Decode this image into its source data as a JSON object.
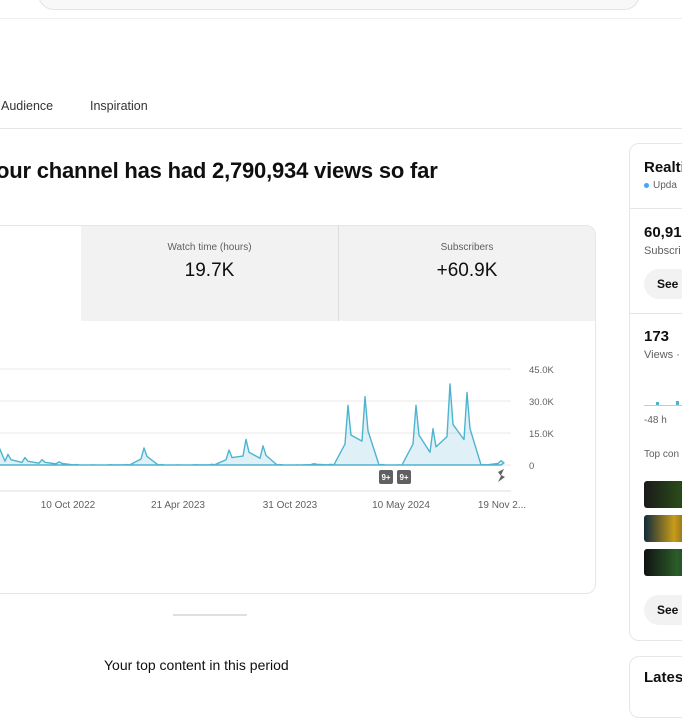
{
  "tabs": [
    {
      "label": "Audience"
    },
    {
      "label": "Inspiration"
    }
  ],
  "headline": "our channel has had 2,790,934 views so far",
  "metrics": [
    {
      "label": "Watch time (hours)",
      "value": "19.7K"
    },
    {
      "label": "Subscribers",
      "value": "+60.9K"
    }
  ],
  "chart_data": {
    "type": "area",
    "y_ticks": [
      "45.0K",
      "30.0K",
      "15.0K",
      "0"
    ],
    "ylim": [
      0,
      45000
    ],
    "x_ticks": [
      "10 Oct 2022",
      "21 Apr 2023",
      "31 Oct 2023",
      "10 May 2024",
      "19 Nov 2..."
    ],
    "markers": [
      "9+",
      "9+"
    ],
    "grid": true,
    "series": [
      {
        "color": "#4fb3d0",
        "x": [
          "2022-05",
          "2022-06",
          "2022-07",
          "2022-08",
          "2022-09",
          "2022-10",
          "2022-11",
          "2022-12",
          "2023-01",
          "2023-02",
          "2023-03",
          "2023-04",
          "2023-05",
          "2023-06",
          "2023-07",
          "2023-08",
          "2023-09",
          "2023-10",
          "2023-11",
          "2023-12",
          "2024-01",
          "2024-02",
          "2024-03",
          "2024-04",
          "2024-05",
          "2024-06",
          "2024-07",
          "2024-08",
          "2024-09",
          "2024-10",
          "2024-11"
        ],
        "values": [
          28000,
          5000,
          3500,
          2500,
          1500,
          200,
          100,
          150,
          200,
          8000,
          200,
          100,
          150,
          300,
          7000,
          12000,
          9000,
          200,
          100,
          600,
          300,
          28000,
          32000,
          200,
          100,
          28000,
          17000,
          38000,
          34000,
          200,
          2000
        ]
      }
    ]
  },
  "right_panel": {
    "title": "Realti",
    "status": "Upda",
    "subs_value": "60,91",
    "subs_label": "Subscri",
    "see_label": "See",
    "views_value": "173",
    "views_label": "Views ·",
    "time_label": "-48 h",
    "top_content_label": "Top con",
    "see_more_label": "See",
    "latest_title": "Lates"
  },
  "top_content_title": "Your top content in this period",
  "colors": {
    "accent": "#4fb3d0",
    "live_dot": "#3ea6ff"
  }
}
